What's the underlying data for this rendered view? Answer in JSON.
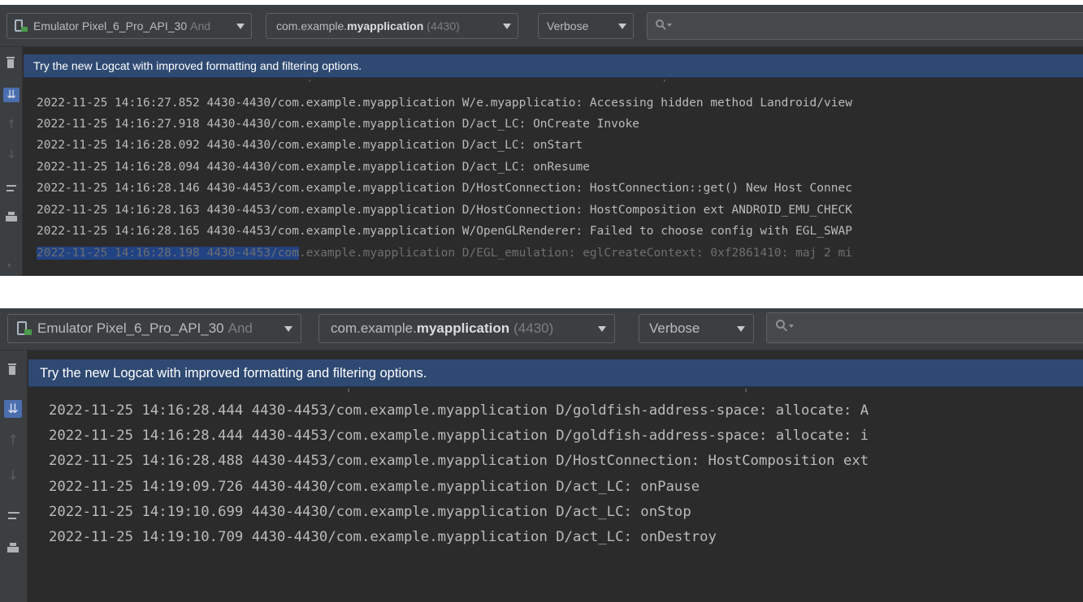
{
  "toolbar": {
    "device": {
      "name": "Emulator Pixel_6_Pro_API_30",
      "suffix": "And"
    },
    "process": {
      "prefix": "com.example.",
      "app": "myapplication",
      "pid": "(4430)"
    },
    "level": "Verbose",
    "search": {
      "placeholder": ""
    }
  },
  "banner": "Try the new Logcat with improved formatting and filtering options.",
  "sidebar_icons": [
    "trash-icon",
    "scroll-to-end-icon",
    "arrow-up-icon",
    "arrow-down-icon",
    "soft-wrap-icon",
    "print-icon",
    "expand-icon"
  ],
  "panel_top": {
    "log_lines": [
      "2022-11-25 14:16:27.852 4430-4430/com.example.myapplication W/e.myapplicatio: Accessing hidden method Landroid/view",
      "2022-11-25 14:16:27.918 4430-4430/com.example.myapplication D/act_LC: OnCreate Invoke",
      "2022-11-25 14:16:28.092 4430-4430/com.example.myapplication D/act_LC: onStart",
      "2022-11-25 14:16:28.094 4430-4430/com.example.myapplication D/act_LC: onResume",
      "2022-11-25 14:16:28.146 4430-4453/com.example.myapplication D/HostConnection: HostConnection::get() New Host Connec",
      "2022-11-25 14:16:28.163 4430-4453/com.example.myapplication D/HostConnection: HostComposition ext ANDROID_EMU_CHECK",
      "2022-11-25 14:16:28.165 4430-4453/com.example.myapplication W/OpenGLRenderer: Failed to choose config with EGL_SWAP"
    ],
    "partial_line_selected": "2022-11-25 14:16:28.198 4430-4453/com",
    "partial_line_rest": ".example.myapplication D/EGL_emulation: eglCreateContext: 0xf2861410: maj 2 mi"
  },
  "panel_bottom": {
    "log_lines": [
      "2022-11-25 14:16:28.444 4430-4453/com.example.myapplication D/goldfish-address-space: allocate: A",
      "2022-11-25 14:16:28.444 4430-4453/com.example.myapplication D/goldfish-address-space: allocate: i",
      "2022-11-25 14:16:28.488 4430-4453/com.example.myapplication D/HostConnection: HostComposition ext",
      "2022-11-25 14:19:09.726 4430-4430/com.example.myapplication D/act_LC: onPause",
      "2022-11-25 14:19:10.699 4430-4430/com.example.myapplication D/act_LC: onStop",
      "2022-11-25 14:19:10.709 4430-4430/com.example.myapplication D/act_LC: onDestroy"
    ]
  }
}
